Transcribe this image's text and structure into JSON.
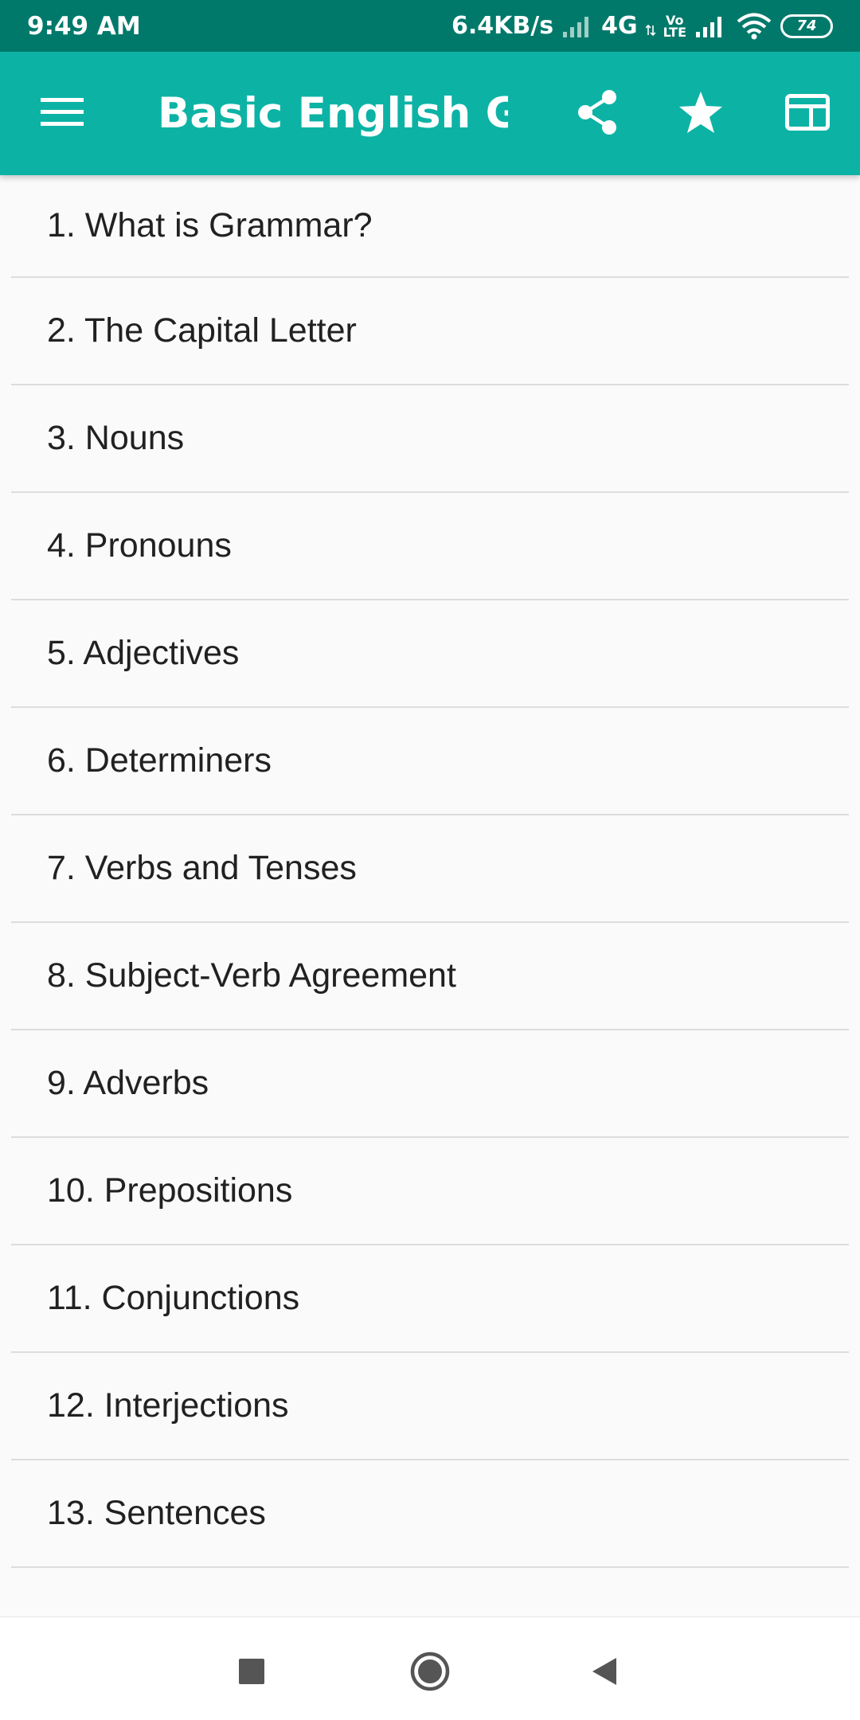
{
  "status_bar": {
    "time": "9:49 AM",
    "speed": "6.4KB/s",
    "network": "4G",
    "volte_top": "Vo",
    "volte_bottom": "LTE",
    "battery": "74",
    "icons": [
      "signal-weak-icon",
      "signal-icon",
      "wifi-icon",
      "battery-icon"
    ]
  },
  "app_bar": {
    "title": "Basic English Gr...",
    "background": "#0cb3a5",
    "icons": [
      "menu-icon",
      "share-icon",
      "star-icon",
      "layout-icon"
    ]
  },
  "topics": [
    "1. What is Grammar?",
    "2. The Capital Letter",
    "3. Nouns",
    "4. Pronouns",
    "5. Adjectives",
    "6. Determiners",
    "7. Verbs and Tenses",
    "8. Subject-Verb Agreement",
    "9. Adverbs",
    "10. Prepositions",
    "11. Conjunctions",
    "12. Interjections",
    "13. Sentences"
  ],
  "nav_bar": {
    "icons": [
      "recents-square-icon",
      "home-circle-icon",
      "back-triangle-icon"
    ]
  },
  "colors": {
    "status_bar": "#00796b",
    "app_bar": "#0cb3a5",
    "list_background": "#fafafa",
    "divider": "#dcdcdc",
    "nav_icon": "#555555"
  }
}
